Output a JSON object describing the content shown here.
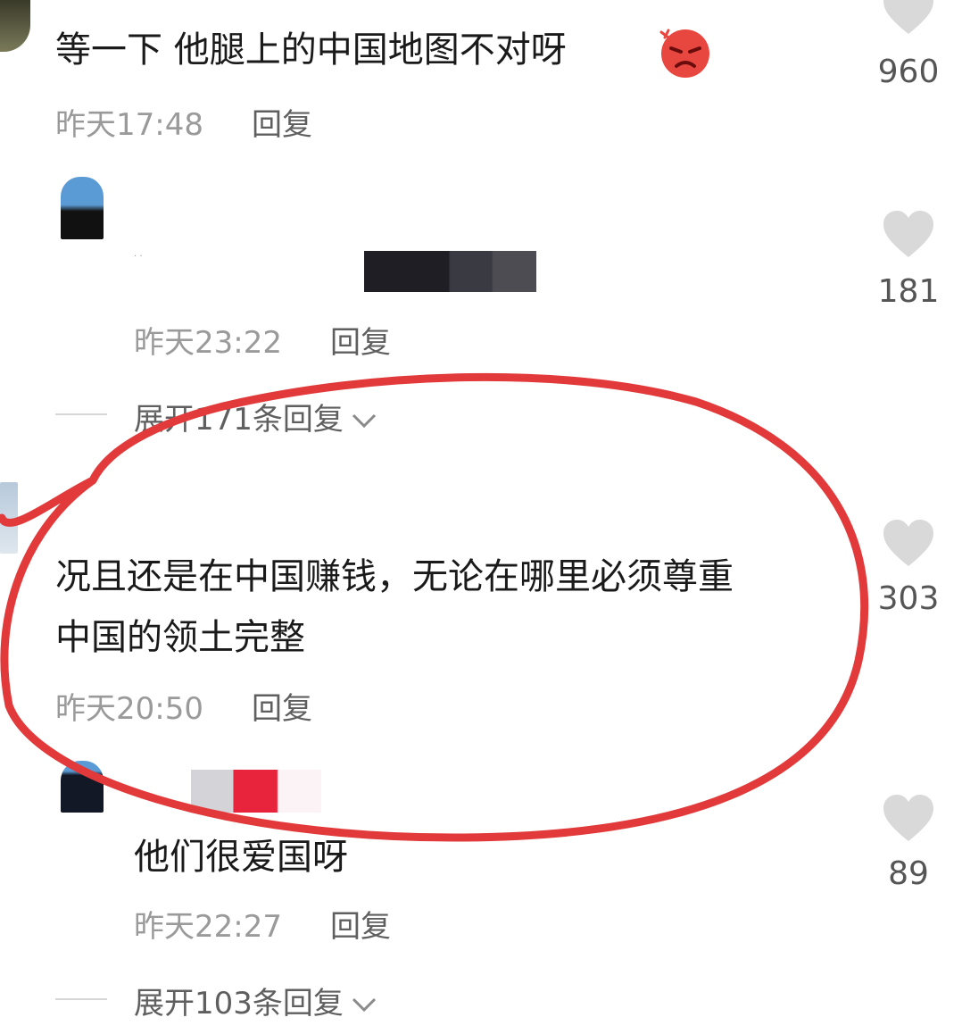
{
  "comments": [
    {
      "text": "等一下  他腿上的中国地图不对呀",
      "emoji_icon": "angry-face-icon",
      "time": "昨天17:48",
      "reply_label": "回复",
      "likes": "960"
    },
    {
      "text": "",
      "time": "昨天23:22",
      "reply_label": "回复",
      "likes": "181",
      "expand_label": "展开171条回复"
    },
    {
      "text_line1": "况且还是在中国赚钱，无论在哪里必须尊重",
      "text_line2": "中国的领土完整",
      "time": "昨天20:50",
      "reply_label": "回复",
      "likes": "303"
    },
    {
      "text": "他们很爱国呀",
      "time": "昨天22:27",
      "reply_label": "回复",
      "likes": "89",
      "expand_label": "展开103条回复"
    }
  ],
  "colors": {
    "highlight_circle": "#e23a3a",
    "heart": "#d9d9d9",
    "meta_text": "#9a9a9a",
    "reply_text": "#5f5f5f"
  }
}
